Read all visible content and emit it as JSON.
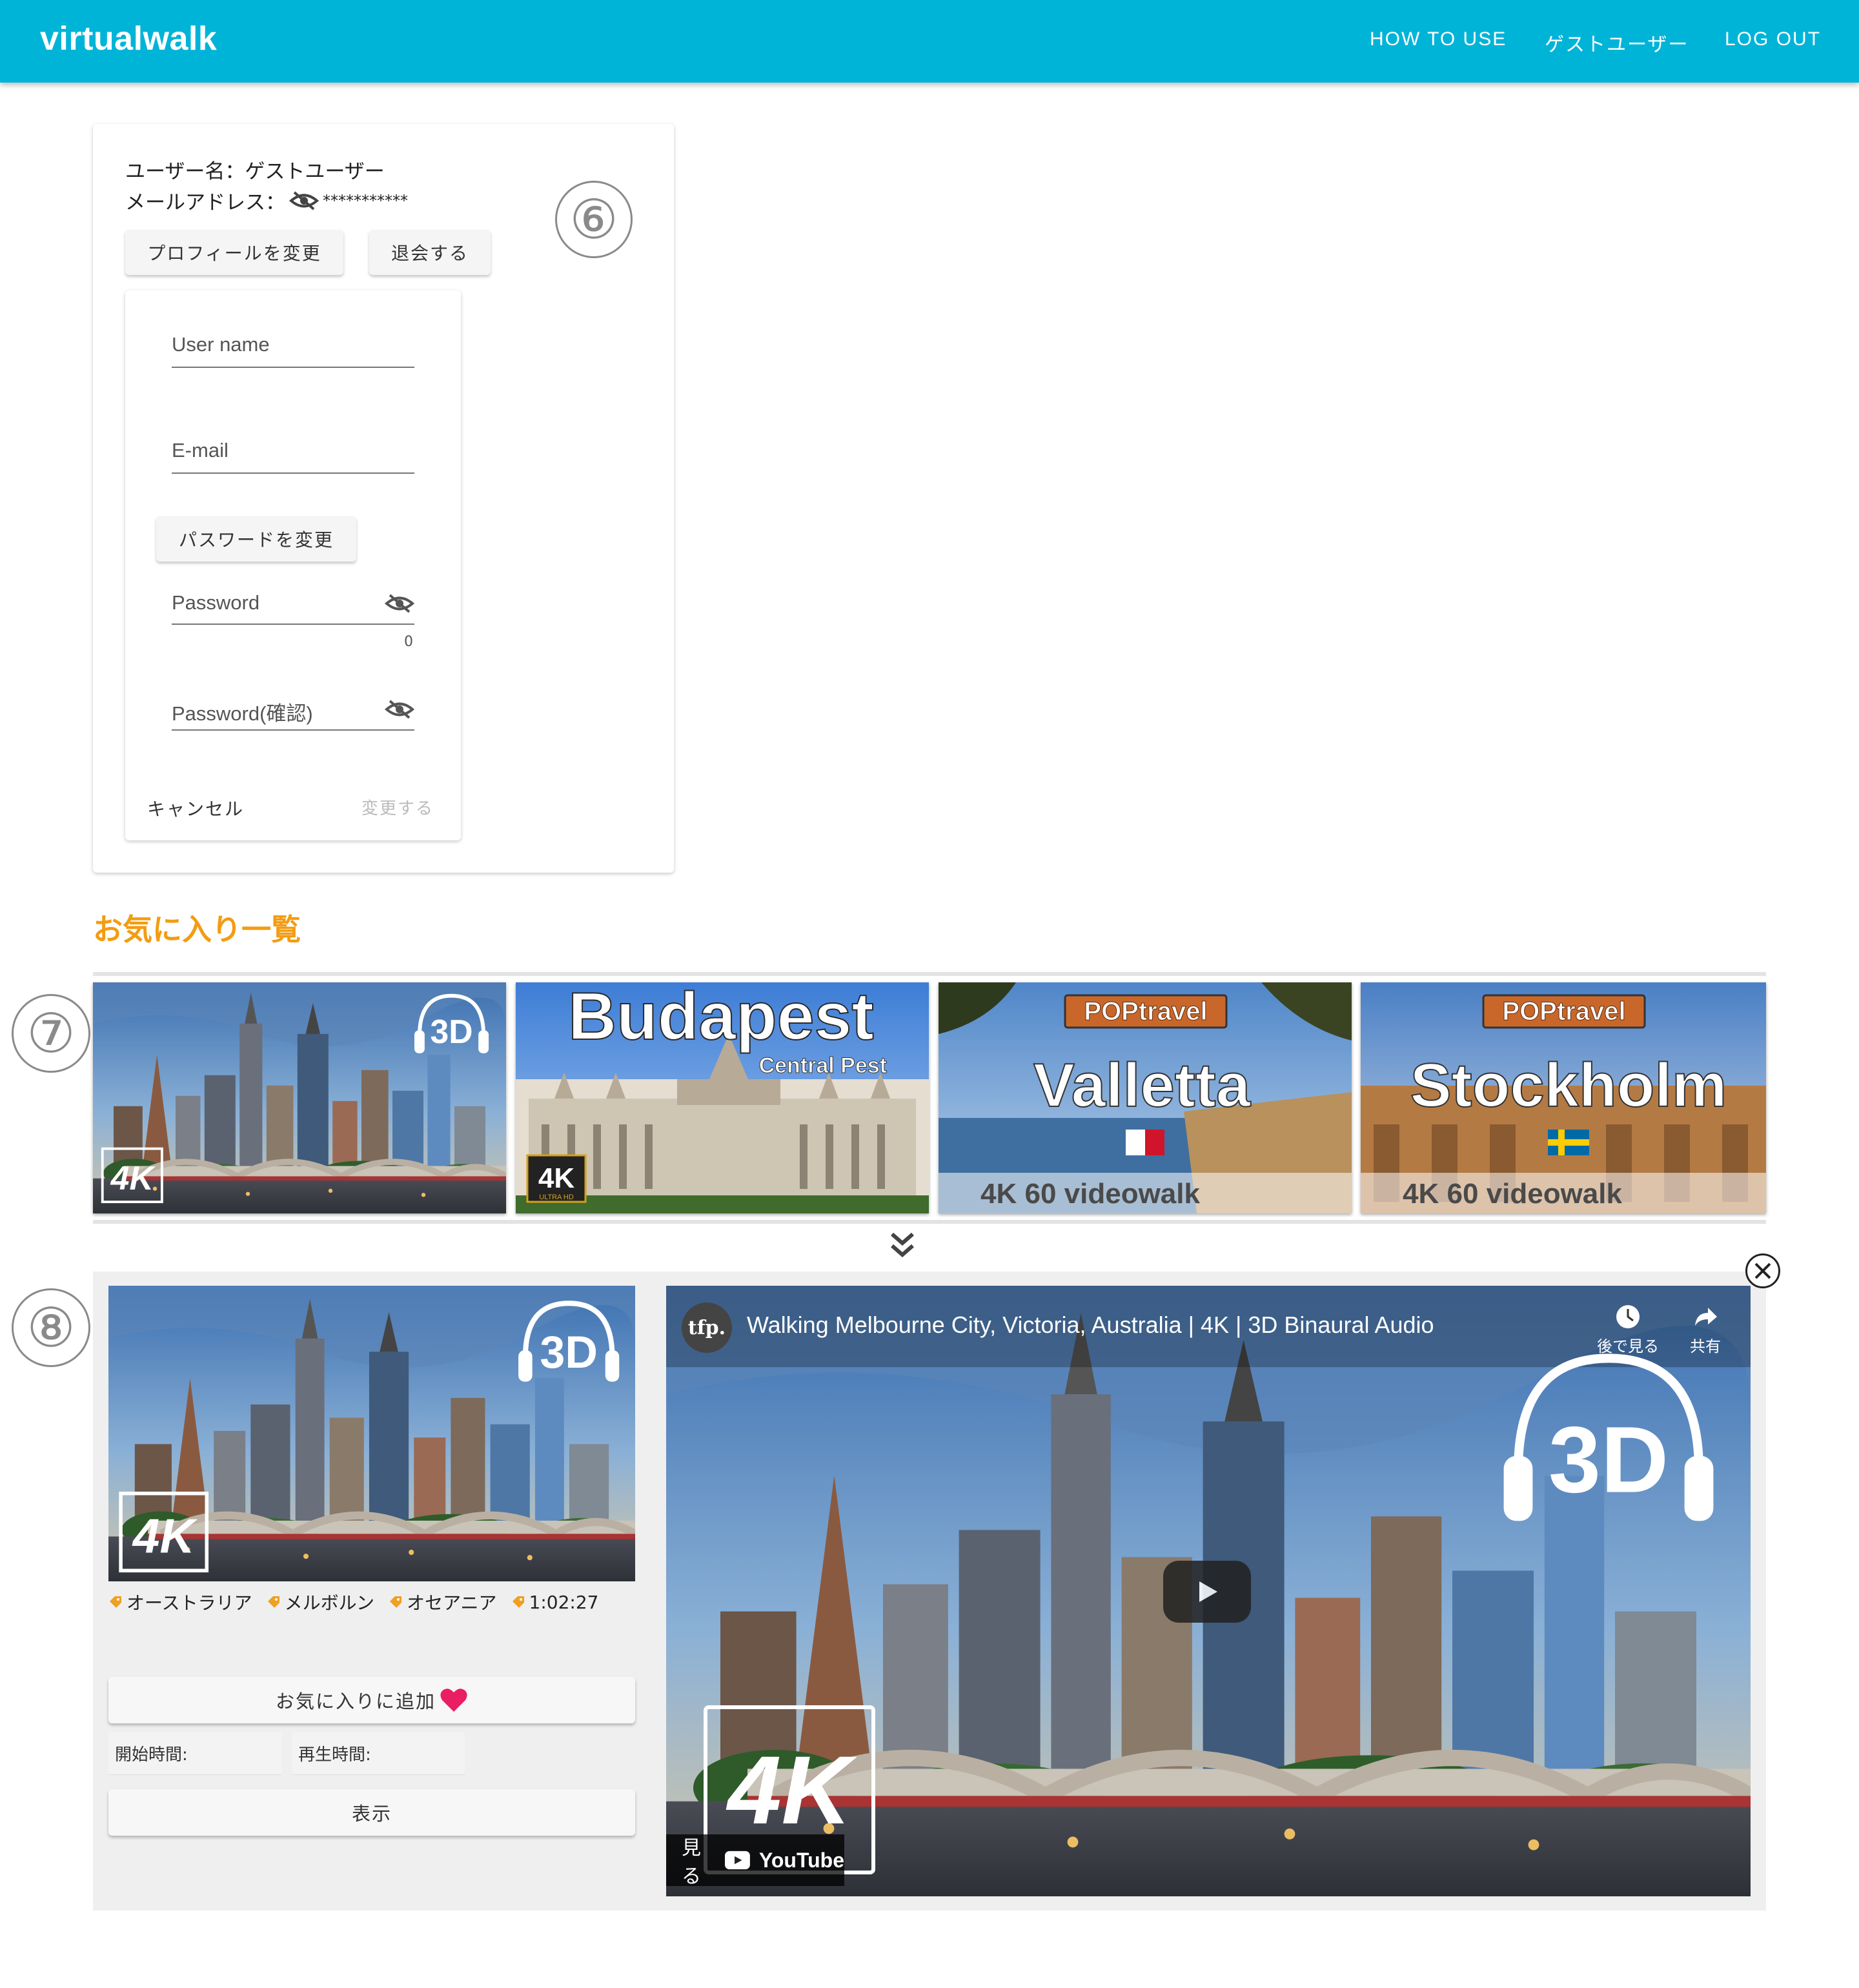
{
  "header": {
    "brand": "virtualwalk",
    "nav": [
      "HOW TO USE",
      "ゲストユーザー",
      "LOG OUT"
    ]
  },
  "profile": {
    "username_line": "ユーザー名：ゲストユーザー",
    "email_label": "メールアドレス：",
    "email_masked": "***********",
    "edit_profile_button": "プロフィールを変更",
    "withdraw_button": "退会する",
    "marker": "⑥"
  },
  "edit_form": {
    "username_placeholder": "User name",
    "email_placeholder": "E-mail",
    "change_password_button": "パスワードを変更",
    "password_placeholder": "Password",
    "password_counter": "0",
    "password_confirm_placeholder": "Password(確認)",
    "cancel_button": "キャンセル",
    "submit_button": "変更する"
  },
  "favorites": {
    "title": "お気に入り一覧",
    "marker": "⑦",
    "thumbnails": [
      {
        "title": "",
        "badge_top": "3D",
        "badge_bottom": "4K",
        "sub": ""
      },
      {
        "title": "Budapest",
        "badge_top": "",
        "badge_bottom": "4K",
        "sub": "Central Pest",
        "badge_small": "ULTRA HD"
      },
      {
        "title": "Valletta",
        "badge_top": "POPtravel",
        "badge_bottom": "4K 60 videowalk",
        "sub": ""
      },
      {
        "title": "Stockholm",
        "badge_top": "POPtravel",
        "badge_bottom": "4K 60 videowalk",
        "sub": ""
      }
    ],
    "expand_icon": "double-chevron-down"
  },
  "detail": {
    "marker": "⑧",
    "thumb_badge_top": "3D",
    "thumb_badge_bottom": "4K",
    "tags": [
      "オーストラリア",
      "メルボルン",
      "オセアニア",
      "1:02:27"
    ],
    "favorite_button": "お気に入りに追加",
    "start_time_label": "開始時間:",
    "play_time_label": "再生時間:",
    "show_button": "表示",
    "video": {
      "channel_logo": "tfp.",
      "title": "Walking Melbourne City, Victoria, Australia | 4K | 3D Binaural Audio",
      "watch_later": "後で見る",
      "share": "共有",
      "badge_3d": "3D",
      "badge_4k": "4K",
      "watch_on": "見る",
      "youtube": "YouTube"
    }
  },
  "colors": {
    "header": "#00b4d8",
    "favorites_title": "#f39c12",
    "heart": "#e91e63"
  }
}
